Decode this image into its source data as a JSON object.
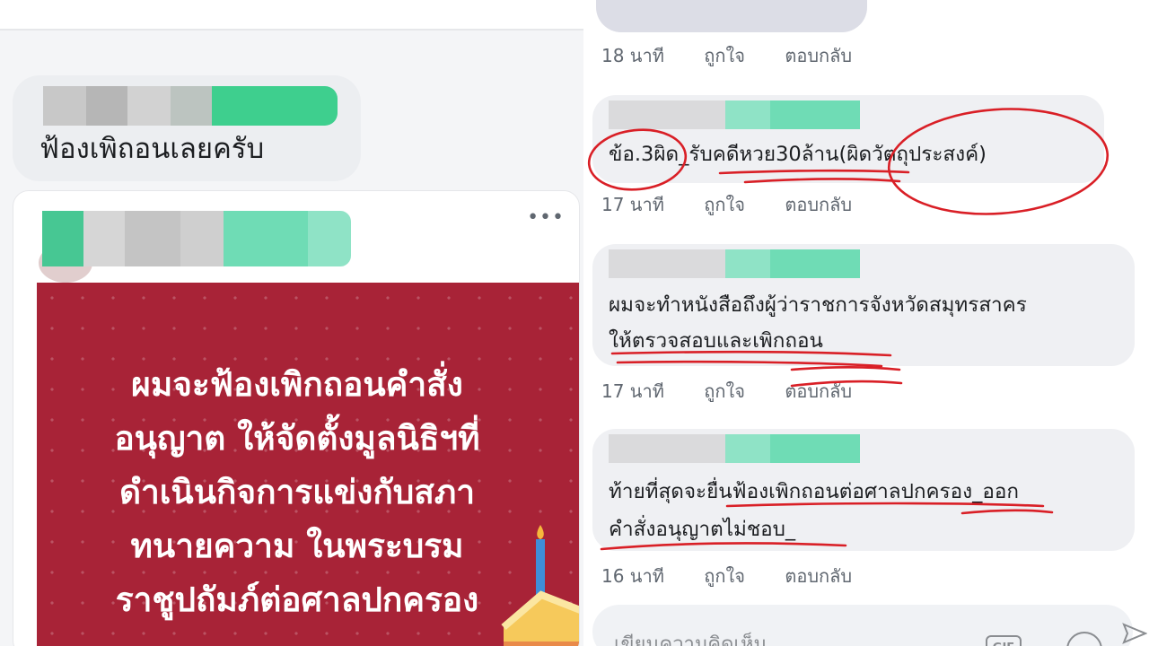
{
  "left": {
    "reply_text": "ฟ้องเพิถอนเลยครับ",
    "more_icon": "more-horizontal-icon",
    "post_text_lines": [
      "ผมจะฟ้องเพิกถอนคำสั่ง",
      "อนุญาต ให้จัดตั้งมูลนิธิฯที่",
      "ดำเนินกิจการแข่งกับสภา",
      "ทนายความ ในพระบรม",
      "ราชูปถัมภ์ต่อศาลปกครอง"
    ],
    "post_bg_color": "#a82337"
  },
  "right": {
    "top_actions": {
      "time": "18 นาที",
      "like": "ถูกใจ",
      "reply": "ตอบกลับ"
    },
    "comments": [
      {
        "lines": [
          "ข้อ.3ผิด_รับคดีหวย30ล้าน(ผิดวัตถุประสงค์)"
        ],
        "time": "17 นาที",
        "like": "ถูกใจ",
        "reply": "ตอบกลับ"
      },
      {
        "lines": [
          "ผมจะทำหนังสือถึงผู้ว่าราชการจังหวัดสมุทรสาคร",
          "ให้ตรวจสอบและเพิกถอน"
        ],
        "time": "17 นาที",
        "like": "ถูกใจ",
        "reply": "ตอบกลับ"
      },
      {
        "lines": [
          "ท้ายที่สุดจะยื่นฟ้องเพิกถอนต่อศาลปกครอง_ออก",
          "คำสั่งอนุญาตไม่ชอบ_"
        ],
        "time": "16 นาที",
        "like": "ถูกใจ",
        "reply": "ตอบกลับ"
      }
    ],
    "comment_box_placeholder": "เขียนความคิดเห็น",
    "gif_label": "GIF",
    "annotation_color": "#d91f26",
    "blur_color": "#3ecf8e"
  }
}
